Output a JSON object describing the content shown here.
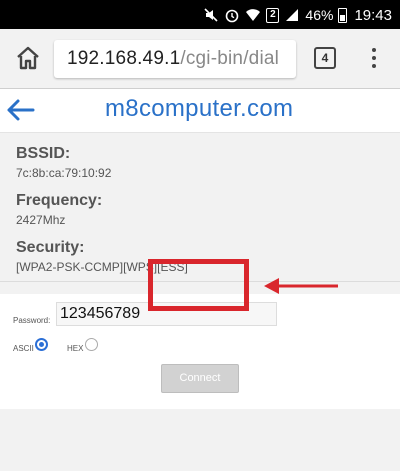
{
  "status_bar": {
    "battery": "46%",
    "time": "19:43",
    "sim_badge": "2",
    "icons": [
      "mute-icon",
      "alarm-icon",
      "wifi-icon",
      "sim2-icon",
      "signal-icon",
      "battery-icon"
    ]
  },
  "browser": {
    "url_host": "192.168.49.1",
    "url_path": "/cgi-bin/dial",
    "tab_count": "4"
  },
  "header": {
    "title": "m8computer.com"
  },
  "network": {
    "bssid_label": "BSSID:",
    "bssid_value": "7c:8b:ca:79:10:92",
    "frequency_label": "Frequency:",
    "frequency_value": "2427Mhz",
    "security_label": "Security:",
    "security_value": "[WPA2-PSK-CCMP][WPS][ESS]"
  },
  "form": {
    "password_label": "Password:",
    "password_value": "123456789",
    "ascii_label": "ASCII",
    "hex_label": "HEX",
    "selected_encoding": "ASCII",
    "connect_label": "Connect"
  },
  "colors": {
    "accent": "#2a71c8",
    "highlight": "#d9262c",
    "radio_selected": "#2b6fd6"
  }
}
